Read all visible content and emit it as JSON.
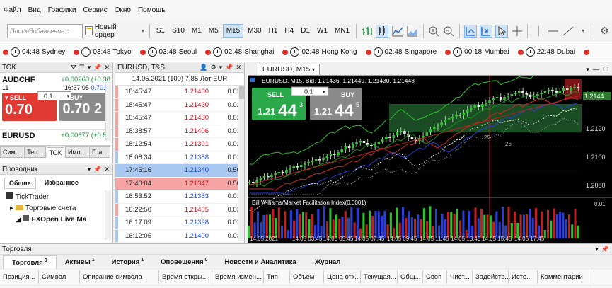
{
  "menu": [
    "Файл",
    "Вид",
    "Графики",
    "Сервис",
    "Окно",
    "Помощь"
  ],
  "toolbar": {
    "search_placeholder": "Поиск/добавление с",
    "new_order_label": "Новый ордер",
    "timeframes": [
      "S1",
      "S10",
      "M1",
      "M5",
      "M15",
      "M30",
      "H1",
      "H4",
      "D1",
      "W1",
      "MN1"
    ],
    "selected_timeframe": "M15"
  },
  "clocks": [
    {
      "time": "04:48",
      "city": "Sydney"
    },
    {
      "time": "03:48",
      "city": "Tokyo"
    },
    {
      "time": "03:48",
      "city": "Seoul"
    },
    {
      "time": "02:48",
      "city": "Shanghai"
    },
    {
      "time": "02:48",
      "city": "Hong Kong"
    },
    {
      "time": "02:48",
      "city": "Singapore"
    },
    {
      "time": "00:18",
      "city": "Mumbai"
    },
    {
      "time": "22:48",
      "city": "Dubai"
    }
  ],
  "market_watch": {
    "title": "ТОК",
    "symbol1": {
      "name": "AUDCHF",
      "change": "+0.00263 (+0.38",
      "count": "11",
      "time": "16:37:05",
      "pct": "0.7017",
      "sell_label": "SELL",
      "sell_big": "0.70 23",
      "sell_sup": "1",
      "lot": "0.1",
      "buy_label": "BUY",
      "buy_big": "0.70 2"
    },
    "symbol2": {
      "name": "EURUSD",
      "change": "+0.00677 (+0.56"
    },
    "tabs": [
      "Сим...",
      "Теп...",
      "ТОК",
      "Имп...",
      "Гра..."
    ],
    "active_tab": "ТОК"
  },
  "navigator": {
    "title": "Проводник",
    "tabs": [
      "Общие",
      "Избранное"
    ],
    "items": [
      "TickTrader",
      "Торговые счета",
      "FXOpen Live Ma"
    ]
  },
  "ts": {
    "title": "EURUSD, T&S",
    "header": "14.05.2021 (100) 7.85 Лот EUR",
    "rows": [
      {
        "t": "18:45:47",
        "p": "1.21430",
        "v": "0.02",
        "dir": "red"
      },
      {
        "t": "18:45:47",
        "p": "1.21430",
        "v": "0.02",
        "dir": "red"
      },
      {
        "t": "18:45:47",
        "p": "1.21430",
        "v": "0.02",
        "dir": "red"
      },
      {
        "t": "18:38:57",
        "p": "1.21406",
        "v": "0.01",
        "dir": "red"
      },
      {
        "t": "18:12:54",
        "p": "1.21391",
        "v": "0.02",
        "dir": "red"
      },
      {
        "t": "18:08:34",
        "p": "1.21388",
        "v": "0.02",
        "dir": "blue"
      },
      {
        "t": "17:45:16",
        "p": "1.21340",
        "v": "0.50",
        "dir": "blue",
        "hl": "blue"
      },
      {
        "t": "17:40:04",
        "p": "1.21347",
        "v": "0.50",
        "dir": "red",
        "hl": "red"
      },
      {
        "t": "16:53:52",
        "p": "1.21363",
        "v": "0.01",
        "dir": "blue"
      },
      {
        "t": "16:22:50",
        "p": "1.21405",
        "v": "0.03",
        "dir": "red"
      },
      {
        "t": "16:17:09",
        "p": "1.21398",
        "v": "0.02",
        "dir": "blue"
      },
      {
        "t": "16:12:05",
        "p": "1.21400",
        "v": "0.03",
        "dir": "blue"
      }
    ]
  },
  "chart": {
    "tab_title": "EURUSD, M15",
    "info": "EURUSD, M15, Bid, 1.21436, 1.21449, 1.21430, 1.21443",
    "sell_label": "SELL",
    "sell_pre": "1.21",
    "sell_big": "44",
    "sell_sup": "3",
    "lot": "0.1",
    "buy_label": "BUY",
    "buy_pre": "1.21",
    "buy_big": "44",
    "buy_sup": "5",
    "price_labels": [
      "1.2140",
      "1.2120",
      "1.2100",
      "1.2080"
    ],
    "price_marker": "1.2144",
    "sub_title": "Bill Williams/Market Facilitation Index(0.0001)",
    "sub_scale": "0.01",
    "time_labels": [
      "14.05.2021",
      "14.05 03:45",
      "14.05 05:45",
      "14.05 07:45",
      "14.05 09:45",
      "14.05 11:45",
      "14.05 13:45",
      "14.05 15:45",
      "14.05 17:45"
    ],
    "marker_25": "25",
    "marker_26": "26"
  },
  "trade": {
    "title": "Торговля",
    "tabs": [
      {
        "label": "Торговля",
        "count": "0"
      },
      {
        "label": "Активы",
        "count": "1"
      },
      {
        "label": "История",
        "count": "1"
      },
      {
        "label": "Оповещения",
        "count": "0"
      },
      {
        "label": "Новости и Аналитика",
        "count": ""
      },
      {
        "label": "Журнал",
        "count": ""
      }
    ],
    "columns": [
      "Позиция...",
      "Символ",
      "Описание символа",
      "Время откры...",
      "Время измен...",
      "Тип",
      "Объем",
      "Цена отк...",
      "Текущая...",
      "Общ...",
      "Своп",
      "Чист...",
      "Задейств...",
      "Исте...",
      "Комментарии"
    ]
  },
  "colors": {
    "sell": "#e03a32",
    "buy": "#8a8a8a",
    "bull_candle": "#2ec22e",
    "accent": "#2a6fd6"
  }
}
